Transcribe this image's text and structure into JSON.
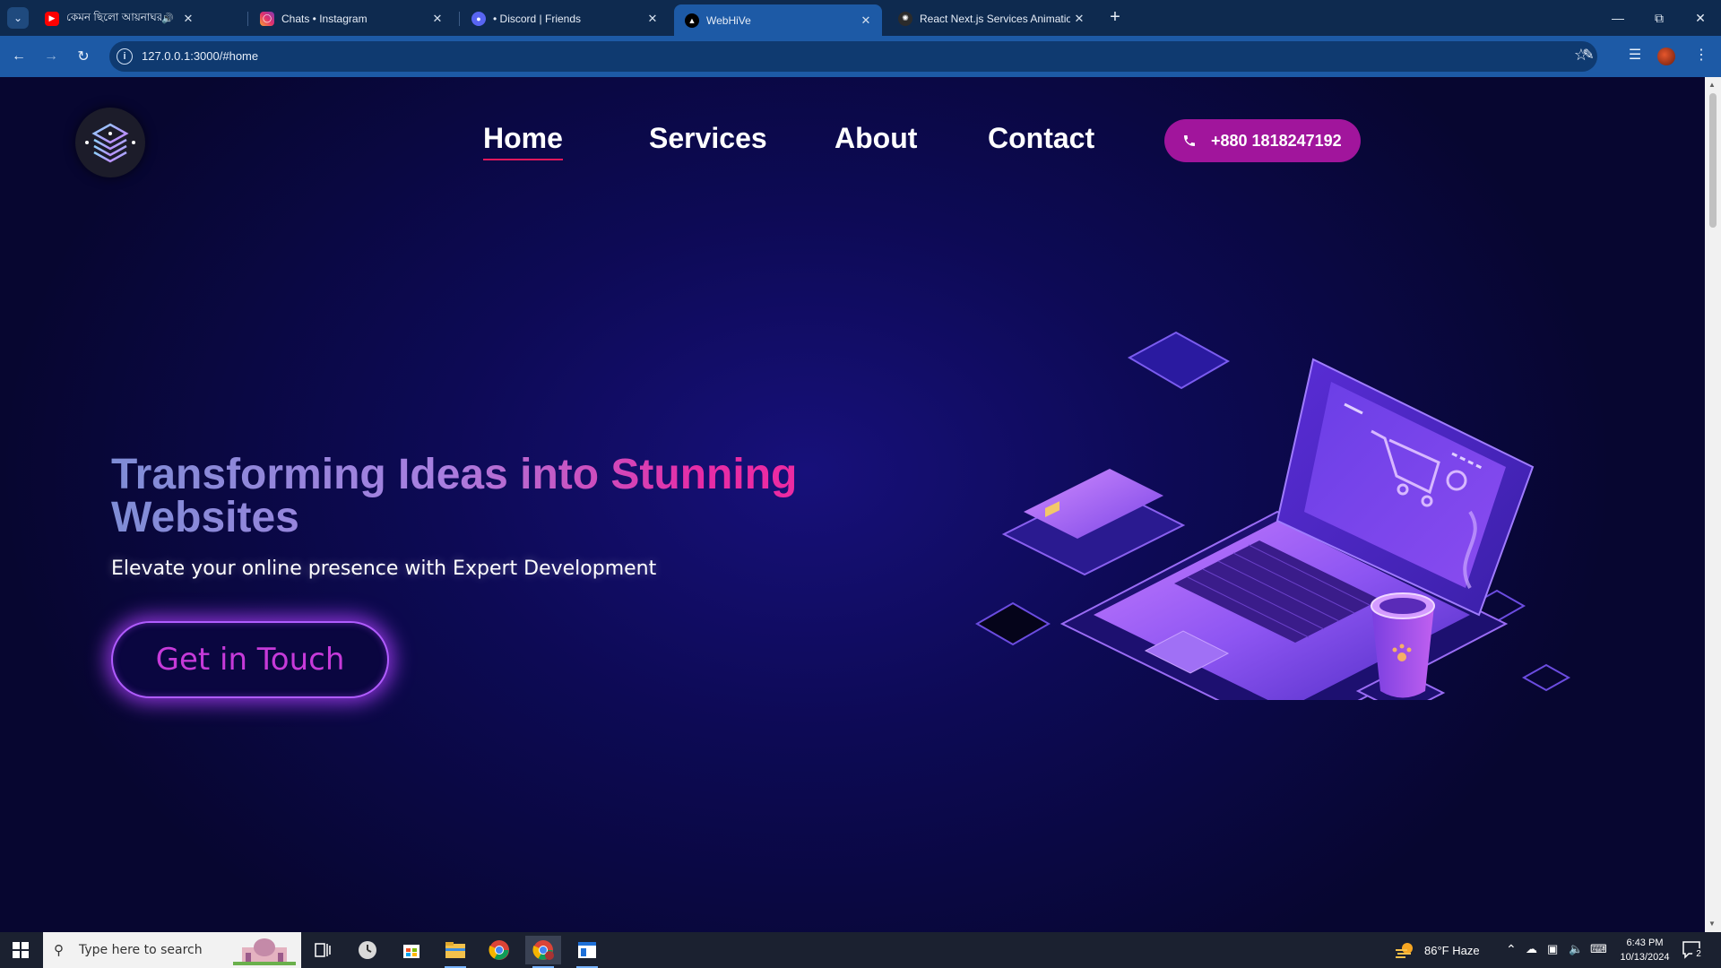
{
  "browser": {
    "tabs": [
      {
        "title": "কেমন ছিলো আয়নাঘর এর ফি",
        "favicon": "youtube-icon",
        "audible": true,
        "active": false
      },
      {
        "title": "Chats • Instagram",
        "favicon": "instagram-icon",
        "active": false
      },
      {
        "title": "• Discord | Friends",
        "favicon": "discord-icon",
        "active": false
      },
      {
        "title": "WebHiVe",
        "favicon": "webhive-icon",
        "active": true
      },
      {
        "title": "React Next.js Services Animatio",
        "favicon": "openai-icon",
        "active": false
      }
    ],
    "url": "127.0.0.1:3000/#home"
  },
  "site": {
    "nav": [
      {
        "label": "Home",
        "active": true
      },
      {
        "label": "Services",
        "active": false
      },
      {
        "label": "About",
        "active": false
      },
      {
        "label": "Contact",
        "active": false
      }
    ],
    "phone": "+880 1818247192",
    "hero": {
      "title_line1": "Transforming Ideas into Stunning",
      "title_line2": "Websites",
      "subtitle": "Elevate your online presence with Expert Development",
      "cta_label": "Get in Touch"
    }
  },
  "taskbar": {
    "search_placeholder": "Type here to search",
    "weather": "86°F  Haze",
    "time": "6:43 PM",
    "date": "10/13/2024",
    "notifications": "2"
  },
  "colors": {
    "accent_magenta": "#a1159c",
    "title_gradient_start": "#7f8dd6",
    "title_gradient_end": "#f02aa0",
    "page_bg": "#0d0a55",
    "nav_underline": "#e0185c"
  }
}
